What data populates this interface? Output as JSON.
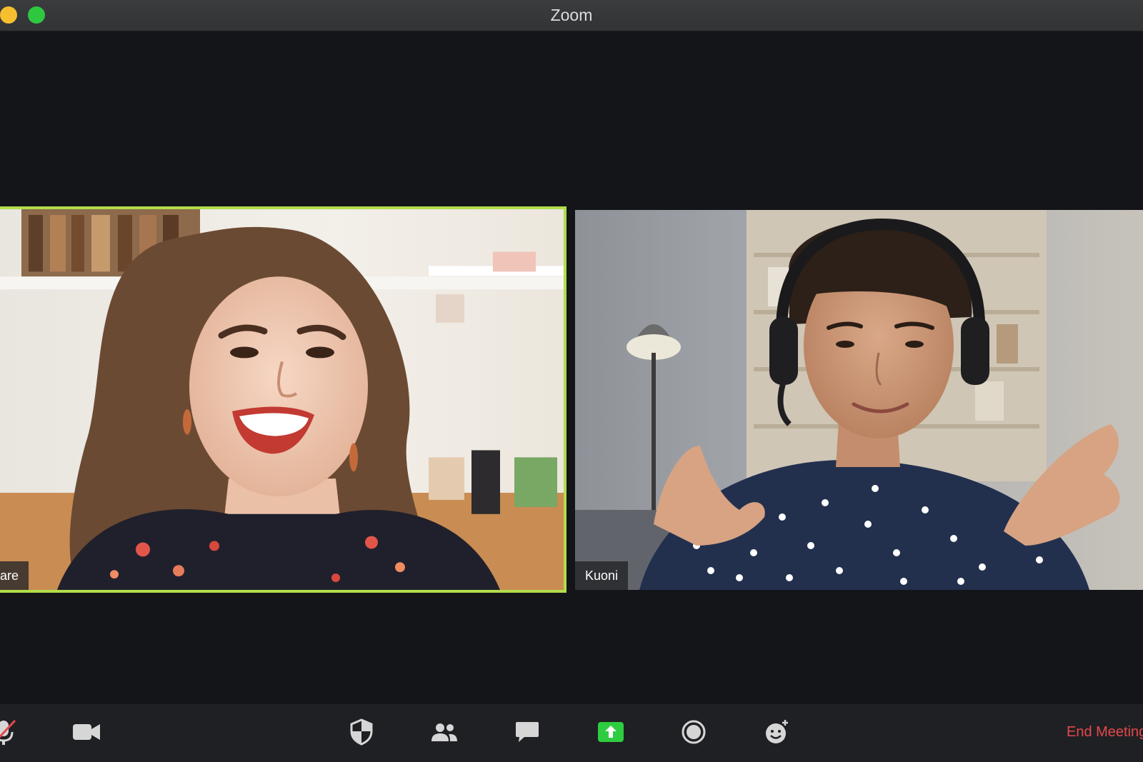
{
  "window": {
    "title": "Zoom"
  },
  "participants": [
    {
      "name": "are",
      "active_speaker": true
    },
    {
      "name": "Kuoni",
      "active_speaker": false
    }
  ],
  "toolbar": {
    "buttons": [
      {
        "icon": "microphone-muted-icon"
      },
      {
        "icon": "video-camera-icon"
      },
      {
        "icon": "security-shield-icon"
      },
      {
        "icon": "participants-icon"
      },
      {
        "icon": "chat-icon"
      },
      {
        "icon": "share-screen-icon"
      },
      {
        "icon": "record-icon"
      },
      {
        "icon": "reactions-icon"
      }
    ],
    "end_label": "End Meeting"
  },
  "colors": {
    "active_speaker_border": "#b2dc4b",
    "share_button": "#2ecc40",
    "end_meeting": "#e5484d",
    "background": "#141518"
  }
}
